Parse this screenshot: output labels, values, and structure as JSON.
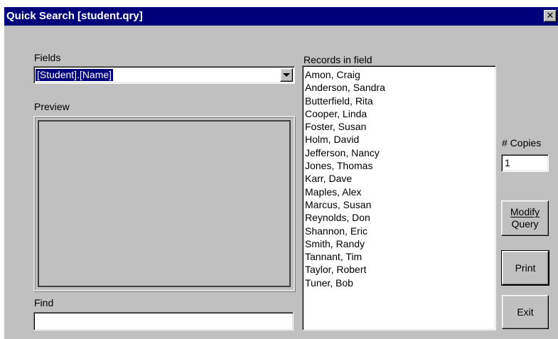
{
  "window": {
    "title": "Quick Search [student.qry]",
    "close_glyph": "✕"
  },
  "fields": {
    "label": "Fields",
    "selected": "[Student].[Name]"
  },
  "preview": {
    "label": "Preview"
  },
  "find": {
    "label": "Find",
    "value": ""
  },
  "records": {
    "label": "Records in field",
    "items": [
      "Amon, Craig",
      "Anderson, Sandra",
      "Butterfield, Rita",
      "Cooper, Linda",
      "Foster, Susan",
      "Holm, David",
      "Jefferson, Nancy",
      "Jones, Thomas",
      "Karr, Dave",
      "Maples, Alex",
      "Marcus, Susan",
      "Reynolds, Don",
      "Shannon, Eric",
      "Smith, Randy",
      "Tannant, Tim",
      "Taylor, Robert",
      "Tuner, Bob"
    ]
  },
  "copies": {
    "label": "# Copies",
    "value": "1"
  },
  "buttons": {
    "modify_line1": "Modify",
    "modify_line2": "Query",
    "print": "Print",
    "exit": "Exit"
  }
}
